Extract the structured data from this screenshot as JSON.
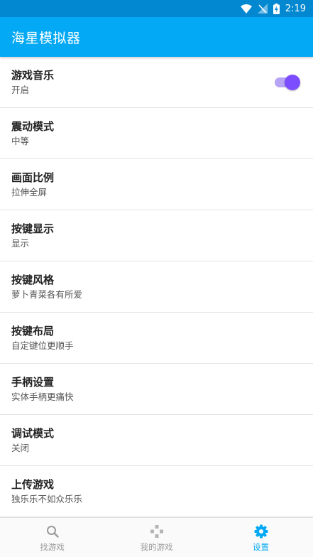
{
  "status_bar": {
    "time": "2:19"
  },
  "app_bar": {
    "title": "海星模拟器"
  },
  "settings": [
    {
      "title": "游戏音乐",
      "summary": "开启",
      "toggle": true
    },
    {
      "title": "震动模式",
      "summary": "中等"
    },
    {
      "title": "画面比例",
      "summary": "拉伸全屏"
    },
    {
      "title": "按键显示",
      "summary": "显示"
    },
    {
      "title": "按键风格",
      "summary": "萝卜青菜各有所爱"
    },
    {
      "title": "按键布局",
      "summary": "自定键位更顺手"
    },
    {
      "title": "手柄设置",
      "summary": "实体手柄更痛快"
    },
    {
      "title": "调试模式",
      "summary": "关闭"
    },
    {
      "title": "上传游戏",
      "summary": "独乐乐不如众乐乐"
    }
  ],
  "bottom_nav": [
    {
      "label": "找游戏",
      "icon": "search-icon",
      "active": false
    },
    {
      "label": "我的游戏",
      "icon": "gamepad-icon",
      "active": false
    },
    {
      "label": "设置",
      "icon": "gear-icon",
      "active": true
    }
  ],
  "colors": {
    "status_bar": "#0288d1",
    "app_bar": "#03a9f4",
    "toggle_accent": "#7c4dff",
    "nav_active": "#03a9f4",
    "nav_inactive": "#9a9a9a"
  }
}
